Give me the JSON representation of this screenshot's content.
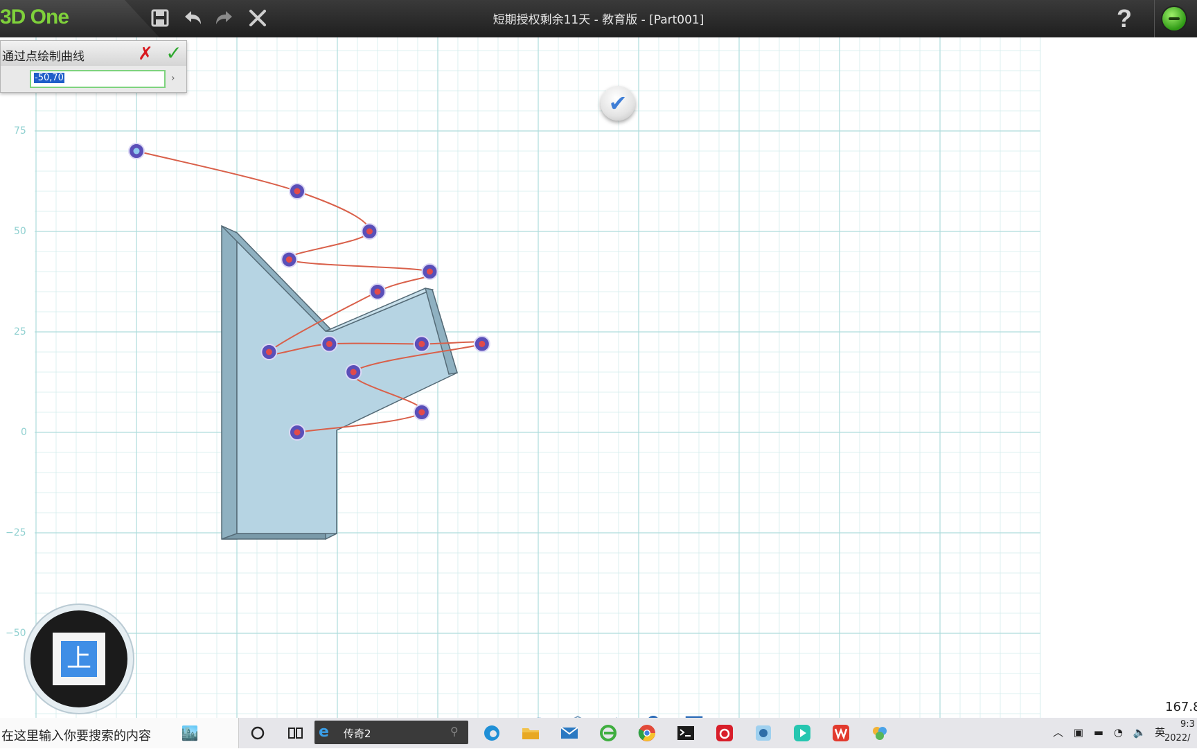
{
  "app": {
    "logo": "3D One",
    "window_title": "短期授权剩余11天 - 教育版 - [Part001]",
    "help_label": "?"
  },
  "toolbar": {
    "icons": [
      "save-icon",
      "undo-icon",
      "redo-icon",
      "close-icon"
    ]
  },
  "command_panel": {
    "title": "通过点绘制曲线",
    "input_value": "-50,70",
    "cancel_symbol": "✗",
    "ok_symbol": "✓",
    "expand_symbol": "›"
  },
  "viewport": {
    "axis_ticks": [
      "75",
      "50",
      "25",
      "0",
      "−25",
      "−50"
    ],
    "grid": true,
    "background_color": "#ffffff",
    "grid_color_minor": "#d3ecec",
    "grid_color_major": "#aedcdc",
    "shape_fill": "#b6d4e3",
    "curve_color": "#d9604a",
    "control_point_color": "#5a4fb8",
    "curve_points_model": [
      [
        -50,
        70
      ],
      [
        -10,
        60
      ],
      [
        8,
        50
      ],
      [
        -12,
        43
      ],
      [
        23,
        40
      ],
      [
        10,
        35
      ],
      [
        -17,
        20
      ],
      [
        -2,
        22
      ],
      [
        21,
        22
      ],
      [
        36,
        22
      ],
      [
        4,
        15
      ],
      [
        21,
        5
      ],
      [
        -10,
        0
      ]
    ]
  },
  "view_cube": {
    "face_label": "上"
  },
  "bottom_tools": {
    "icons": [
      "eye-icon",
      "cube-wire-icon",
      "cube-solid-icon",
      "zoom-icon",
      "fit-view-icon"
    ]
  },
  "coordinate_readout": "167.8",
  "taskbar": {
    "search_placeholder": "在这里输入你要搜索的内容",
    "active_window_label": "传奇2",
    "ime_label": "英",
    "clock_time": "9:3",
    "clock_date": "2022/"
  }
}
